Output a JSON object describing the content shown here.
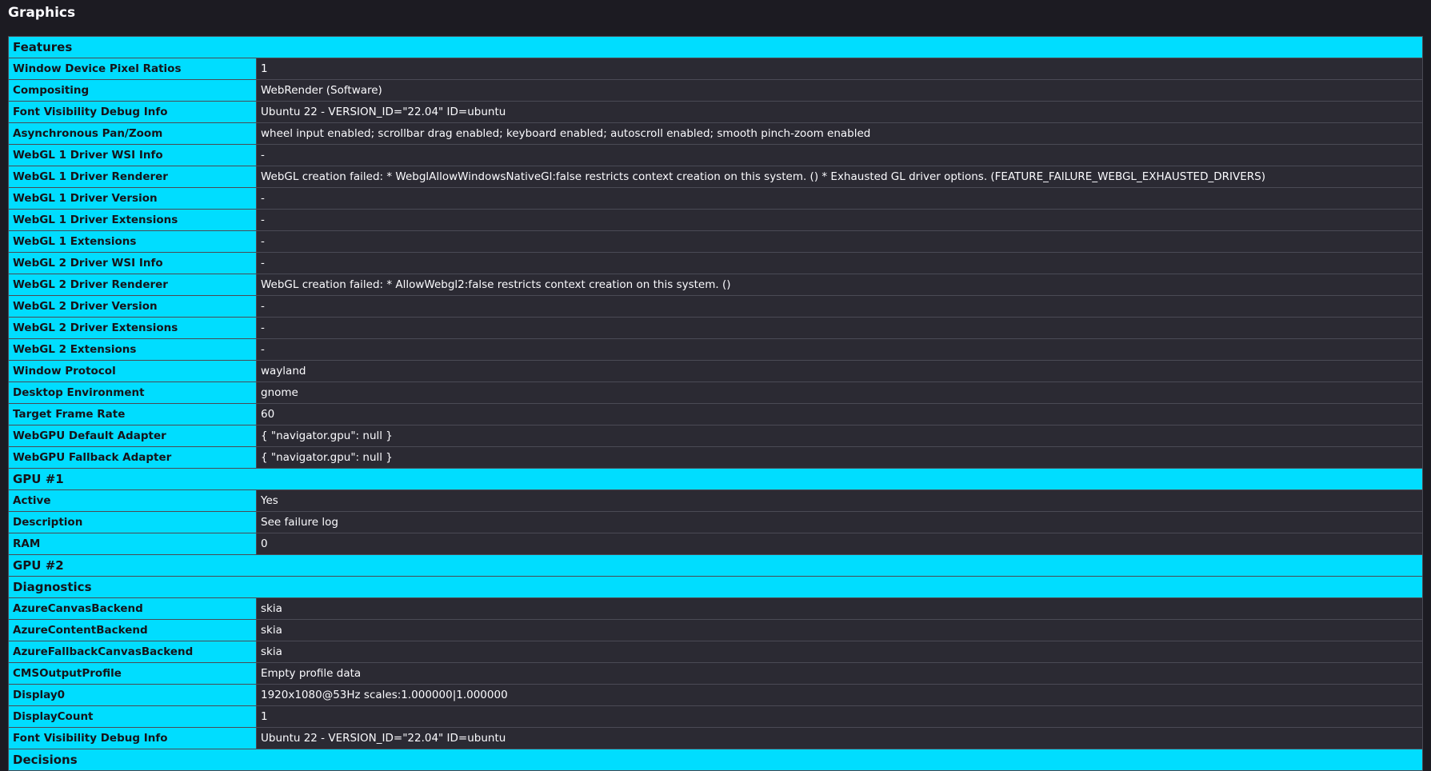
{
  "page": {
    "title": "Graphics"
  },
  "colors": {
    "background": "#1c1b22",
    "header_accent": "#00ddff",
    "value_cell": "#2b2a33",
    "border": "#4a4a55"
  },
  "sections": [
    {
      "title": "Features",
      "rows": [
        {
          "key": "Window Device Pixel Ratios",
          "value": "1"
        },
        {
          "key": "Compositing",
          "value": "WebRender (Software)"
        },
        {
          "key": "Font Visibility Debug Info",
          "value": "Ubuntu 22 - VERSION_ID=\"22.04\" ID=ubuntu"
        },
        {
          "key": "Asynchronous Pan/Zoom",
          "value": "wheel input enabled; scrollbar drag enabled; keyboard enabled; autoscroll enabled; smooth pinch-zoom enabled"
        },
        {
          "key": "WebGL 1 Driver WSI Info",
          "value": "-"
        },
        {
          "key": "WebGL 1 Driver Renderer",
          "value": "WebGL creation failed: * WebglAllowWindowsNativeGl:false restricts context creation on this system. () * Exhausted GL driver options. (FEATURE_FAILURE_WEBGL_EXHAUSTED_DRIVERS)"
        },
        {
          "key": "WebGL 1 Driver Version",
          "value": "-"
        },
        {
          "key": "WebGL 1 Driver Extensions",
          "value": "-"
        },
        {
          "key": "WebGL 1 Extensions",
          "value": "-"
        },
        {
          "key": "WebGL 2 Driver WSI Info",
          "value": "-"
        },
        {
          "key": "WebGL 2 Driver Renderer",
          "value": "WebGL creation failed: * AllowWebgl2:false restricts context creation on this system. ()"
        },
        {
          "key": "WebGL 2 Driver Version",
          "value": "-"
        },
        {
          "key": "WebGL 2 Driver Extensions",
          "value": "-"
        },
        {
          "key": "WebGL 2 Extensions",
          "value": "-"
        },
        {
          "key": "Window Protocol",
          "value": "wayland"
        },
        {
          "key": "Desktop Environment",
          "value": "gnome"
        },
        {
          "key": "Target Frame Rate",
          "value": "60"
        },
        {
          "key": "WebGPU Default Adapter",
          "value": "{ \"navigator.gpu\": null }"
        },
        {
          "key": "WebGPU Fallback Adapter",
          "value": "{ \"navigator.gpu\": null }"
        }
      ]
    },
    {
      "title": "GPU #1",
      "rows": [
        {
          "key": "Active",
          "value": "Yes"
        },
        {
          "key": "Description",
          "value": "See failure log"
        },
        {
          "key": "RAM",
          "value": "0"
        }
      ]
    },
    {
      "title": "GPU #2",
      "rows": []
    },
    {
      "title": "Diagnostics",
      "rows": [
        {
          "key": "AzureCanvasBackend",
          "value": "skia"
        },
        {
          "key": "AzureContentBackend",
          "value": "skia"
        },
        {
          "key": "AzureFallbackCanvasBackend",
          "value": "skia"
        },
        {
          "key": "CMSOutputProfile",
          "value": "Empty profile data"
        },
        {
          "key": "Display0",
          "value": "1920x1080@53Hz scales:1.000000|1.000000"
        },
        {
          "key": "DisplayCount",
          "value": "1"
        },
        {
          "key": "Font Visibility Debug Info",
          "value": "Ubuntu 22 - VERSION_ID=\"22.04\" ID=ubuntu"
        }
      ]
    },
    {
      "title": "Decisions",
      "rows": []
    }
  ]
}
